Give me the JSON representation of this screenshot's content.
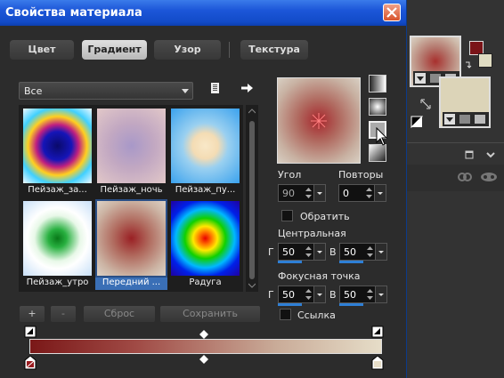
{
  "dialog": {
    "title": "Свойства материала",
    "tabs": [
      {
        "label": "Цвет",
        "active": false
      },
      {
        "label": "Градиент",
        "active": true
      },
      {
        "label": "Узор",
        "active": false
      },
      {
        "label": "Текстура",
        "active": false
      }
    ],
    "category_dropdown": {
      "value": "Все"
    },
    "thumbnails": [
      {
        "label": "Пейзаж_за...",
        "selected": false
      },
      {
        "label": "Пейзаж_ночь",
        "selected": false
      },
      {
        "label": "Пейзаж_пу...",
        "selected": false
      },
      {
        "label": "Пейзаж_утро",
        "selected": false
      },
      {
        "label": "Передний ...",
        "selected": true
      },
      {
        "label": "Радуга",
        "selected": false
      }
    ],
    "buttons": {
      "add": "+",
      "remove": "-",
      "reset": "Сброс",
      "save": "Сохранить"
    },
    "angle": {
      "label": "Угол",
      "value": "90"
    },
    "repeats": {
      "label": "Повторы",
      "value": "0"
    },
    "invert": {
      "label": "Обратить",
      "checked": false
    },
    "center": {
      "label": "Центральная",
      "g_label": "Г",
      "g_value": "50",
      "v_label": "В",
      "v_value": "50"
    },
    "focal": {
      "label": "Фокусная точка",
      "g_label": "Г",
      "g_value": "50",
      "v_label": "В",
      "v_value": "50"
    },
    "link": {
      "label": "Ссылка",
      "checked": false
    },
    "gradient": {
      "start_color": "#7a1818",
      "end_color": "#e6ddc8"
    }
  },
  "materials_panel": {
    "foreground_color": "#7a1418",
    "background_color": "#e0dcc2"
  }
}
